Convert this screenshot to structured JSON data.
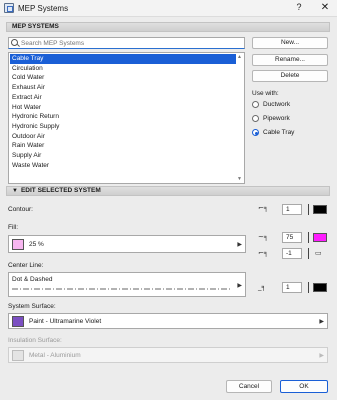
{
  "window": {
    "title": "MEP Systems",
    "help_glyph": "?",
    "close_glyph": "✕"
  },
  "systems_section": {
    "title": "MEP SYSTEMS",
    "search_placeholder": "Search MEP Systems",
    "items": [
      "Cable Tray",
      "Circulation",
      "Cold Water",
      "Exhaust Air",
      "Extract Air",
      "Hot Water",
      "Hydronic Return",
      "Hydronic Supply",
      "Outdoor Air",
      "Rain Water",
      "Supply Air",
      "Waste Water"
    ],
    "selected_index": 0,
    "buttons": {
      "new": "New...",
      "rename": "Rename...",
      "delete": "Delete"
    },
    "use_with_label": "Use with:",
    "use_with_options": [
      "Ductwork",
      "Pipework",
      "Cable Tray"
    ],
    "use_with_selected": "Cable Tray"
  },
  "edit_section": {
    "title": "EDIT SELECTED SYSTEM",
    "contour_label": "Contour:",
    "contour_pen": "1",
    "fill_label": "Fill:",
    "fill_value": "25 %",
    "fill_color": "#f7b6f0",
    "fill_pen": "75",
    "fill_pen_color": "#ff1dff",
    "fill_bg_pen": "-1",
    "center_line_label": "Center Line:",
    "center_line_value": "Dot & Dashed",
    "center_line_pen": "1",
    "system_surface_label": "System Surface:",
    "system_surface_value": "Paint - Ultramarine Violet",
    "system_surface_color": "#7b4fc2",
    "insulation_surface_label": "Insulation Surface:",
    "insulation_surface_value": "Metal - Aluminium"
  },
  "footer": {
    "cancel": "Cancel",
    "ok": "OK"
  },
  "colors": {
    "accent": "#1a5fd6",
    "pen_black": "#000000"
  }
}
